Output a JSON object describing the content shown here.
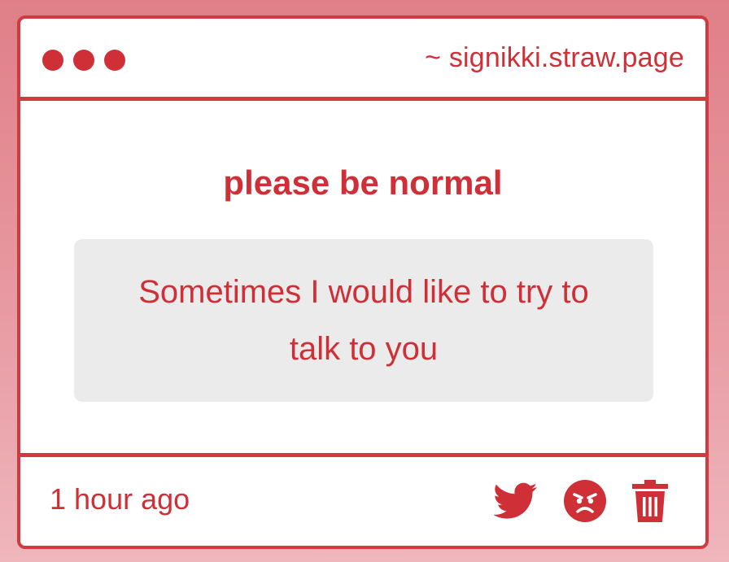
{
  "header": {
    "url": "~ signikki.straw.page"
  },
  "post": {
    "title": "please be normal",
    "message": "Sometimes I would like to try to talk to you",
    "time": "1 hour ago"
  },
  "actions": {
    "icons": [
      "twitter-icon",
      "angry-face-icon",
      "trash-icon"
    ]
  },
  "colors": {
    "accent": "#cf2f36",
    "background": "#e89aa2",
    "message_box": "#ebebec"
  }
}
